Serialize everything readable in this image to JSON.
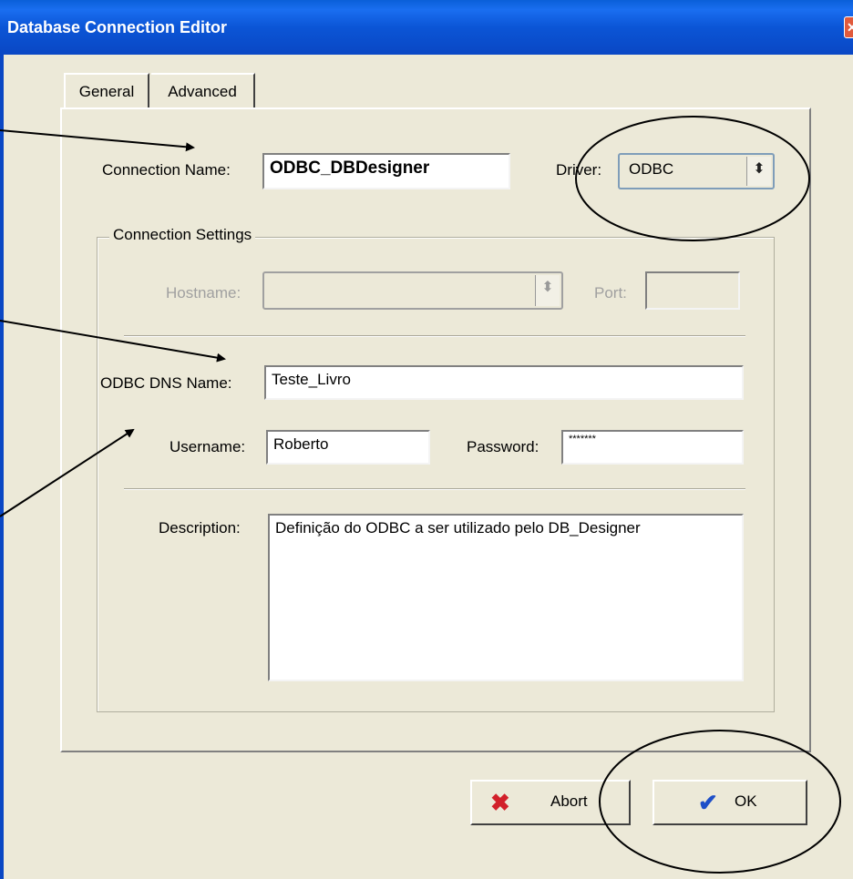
{
  "window": {
    "title": "Database Connection Editor",
    "close_icon": "close-icon"
  },
  "tabs": [
    {
      "label": "General",
      "selected": true
    },
    {
      "label": "Advanced",
      "selected": false
    }
  ],
  "connection": {
    "name_label": "Connection Name:",
    "name_value": "ODBC_DBDesigner",
    "driver_label": "Driver:",
    "driver_value": "ODBC"
  },
  "settings": {
    "group_title": "Connection Settings",
    "hostname_label": "Hostname:",
    "hostname_value": "",
    "port_label": "Port:",
    "port_value": "",
    "dns_label": "ODBC DNS Name:",
    "dns_value": "Teste_Livro",
    "username_label": "Username:",
    "username_value": "Roberto",
    "password_label": "Password:",
    "password_value": "*******",
    "description_label": "Description:",
    "description_value": "Definição do ODBC a ser utilizado pelo DB_Designer"
  },
  "buttons": {
    "abort_label": "Abort",
    "abort_icon": "x-icon",
    "ok_label": "OK",
    "ok_icon": "checkmark-icon"
  },
  "colors": {
    "titlebar": "#0a55d6",
    "face": "#ece9d8",
    "abort_icon": "#d2202a",
    "ok_icon": "#1e4fc8"
  }
}
